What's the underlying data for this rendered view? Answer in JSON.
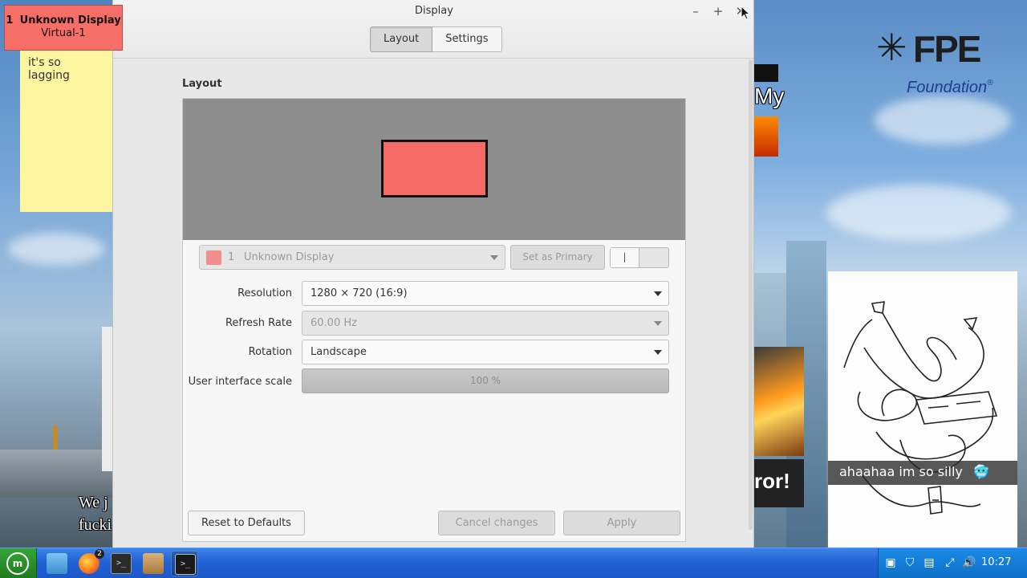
{
  "identify_badge": {
    "number": "1",
    "name": "Unknown Display",
    "connector": "Virtual-1"
  },
  "sticky_note": {
    "text": "it's so lagging"
  },
  "desktop": {
    "logo_text": "FPE",
    "logo_subtext": "Foundation",
    "logo_reg": "®",
    "meme_left_line1": "We j",
    "meme_left_line2": "fucki",
    "meme_my": "My",
    "meme_ror": "ror!",
    "drawing_caption": "ahaahaa im so silly"
  },
  "window": {
    "title": "Display",
    "minimize_icon": "minimize-icon",
    "maximize_icon": "maximize-icon",
    "close_icon": "close-icon",
    "tabs": [
      {
        "label": "Layout",
        "active": true
      },
      {
        "label": "Settings",
        "active": false
      }
    ]
  },
  "layout": {
    "section_title": "Layout",
    "monitor_color": "#f56a64",
    "display_select": {
      "number": "1",
      "name": "Unknown Display"
    },
    "set_primary_label": "Set as Primary",
    "toggle_knob": "|",
    "fields": {
      "resolution": {
        "label": "Resolution",
        "value": "1280 × 720 (16:9)"
      },
      "refresh_rate": {
        "label": "Refresh Rate",
        "value": "60.00 Hz"
      },
      "rotation": {
        "label": "Rotation",
        "value": "Landscape"
      },
      "ui_scale": {
        "label": "User interface scale",
        "value": "100 %"
      }
    },
    "buttons": {
      "reset": "Reset to Defaults",
      "cancel": "Cancel changes",
      "apply": "Apply"
    }
  },
  "taskbar": {
    "start_icon": "mint-logo-icon",
    "items": [
      {
        "name": "files-icon",
        "active": false
      },
      {
        "name": "firefox-icon",
        "badge": "2",
        "active": false
      },
      {
        "name": "terminal-icon",
        "active": false
      },
      {
        "name": "archive-icon",
        "active": false
      },
      {
        "name": "terminal-window-icon",
        "active": true
      }
    ],
    "tray": [
      "clipboard-icon",
      "shield-icon",
      "notes-icon",
      "network-icon",
      "volume-icon"
    ],
    "clock": "10:27"
  }
}
